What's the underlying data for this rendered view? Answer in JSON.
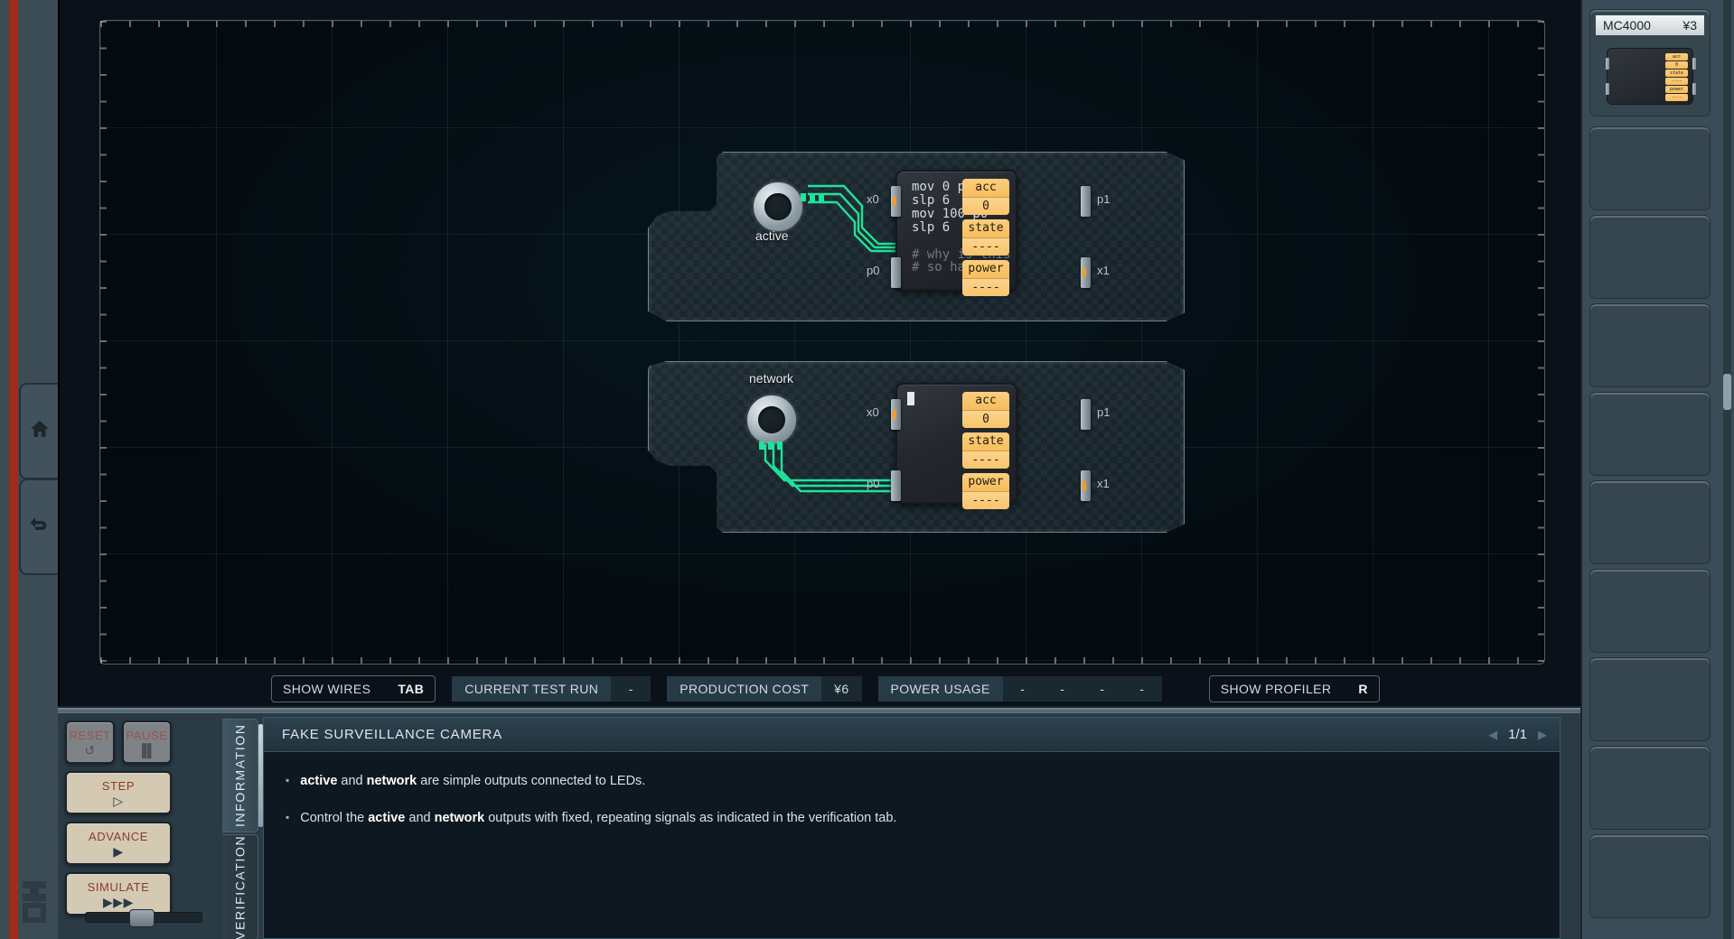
{
  "rail": {
    "home_icon": "home-icon",
    "back_icon": "undo-arrow-icon",
    "logo_icon": "shenzhen-logo-icon"
  },
  "canvas": {
    "modules": [
      {
        "id": "module-active",
        "led_label": "active",
        "chip": {
          "code_lines": [
            "mov 0 p0",
            "slp 6",
            "mov 100 p0",
            "slp 6"
          ],
          "comment_lines": [
            "# why is this",
            "# so hard? :("
          ],
          "registers": [
            {
              "name": "acc",
              "value": "0"
            },
            {
              "name": "state",
              "value": "----"
            },
            {
              "name": "power",
              "value": "----"
            }
          ],
          "ports_left": [
            "x0",
            "p0"
          ],
          "ports_right": [
            "p1",
            "x1"
          ],
          "cursor_visible": false
        }
      },
      {
        "id": "module-network",
        "led_label": "network",
        "chip": {
          "code_lines": [],
          "comment_lines": [],
          "registers": [
            {
              "name": "acc",
              "value": "0"
            },
            {
              "name": "state",
              "value": "----"
            },
            {
              "name": "power",
              "value": "----"
            }
          ],
          "ports_left": [
            "x0",
            "p0"
          ],
          "ports_right": [
            "p1",
            "x1"
          ],
          "cursor_visible": true
        }
      }
    ],
    "trace_color": "#1ee39a"
  },
  "statusbar": {
    "show_wires_label": "SHOW WIRES",
    "show_wires_key": "TAB",
    "current_test_run_label": "CURRENT TEST RUN",
    "current_test_run_value": "-",
    "production_cost_label": "PRODUCTION COST",
    "production_cost_value": "¥6",
    "power_usage_label": "POWER USAGE",
    "power_usage_values": [
      "-",
      "-",
      "-",
      "-"
    ],
    "show_profiler_label": "SHOW PROFILER",
    "show_profiler_key": "R"
  },
  "controls": {
    "reset_label": "RESET",
    "reset_glyph": "↺",
    "pause_label": "PAUSE",
    "pause_glyph": "▐▌",
    "step_label": "STEP",
    "step_glyph": "▷",
    "advance_label": "ADVANCE",
    "advance_glyph": "▶",
    "simulate_label": "SIMULATE",
    "simulate_glyph": "▶▶▶"
  },
  "tabs": {
    "information": "INFORMATION",
    "verification": "VERIFICATION"
  },
  "document": {
    "title": "FAKE SURVEILLANCE CAMERA",
    "page": "1/1",
    "prev_arrow": "◀",
    "next_arrow": "▶",
    "bullet_marker": "▪",
    "bullets": [
      {
        "parts": [
          {
            "text": "active",
            "bold": true
          },
          {
            "text": " and ",
            "bold": false
          },
          {
            "text": "network",
            "bold": true
          },
          {
            "text": " are simple outputs connected to LEDs.",
            "bold": false
          }
        ]
      },
      {
        "parts": [
          {
            "text": "Control the ",
            "bold": false
          },
          {
            "text": "active",
            "bold": true
          },
          {
            "text": " and ",
            "bold": false
          },
          {
            "text": "network",
            "bold": true
          },
          {
            "text": " outputs with fixed, repeating signals as indicated in the verification tab.",
            "bold": false
          }
        ]
      }
    ]
  },
  "sidebar": {
    "parts": [
      {
        "name": "MC4000",
        "cost": "¥3",
        "mini_registers": [
          "acc",
          "0",
          "state",
          "----",
          "power",
          "----"
        ]
      }
    ],
    "empty_slot_count": 9
  },
  "colors": {
    "accent_green": "#1ee39a",
    "register_yellow": "#f9c46b",
    "panel_blue": "#2a3b46",
    "canvas_dark": "#030a10",
    "button_tan": "#d4cab4",
    "button_red_text": "#8d3a2c",
    "rail_red": "#9c2d1f"
  }
}
